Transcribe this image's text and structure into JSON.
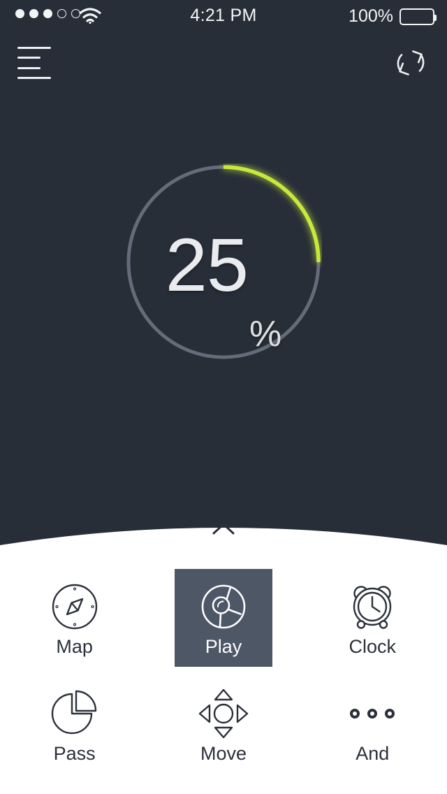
{
  "status_bar": {
    "signal_dots_total": 5,
    "signal_dots_filled": 3,
    "wifi_icon": "wifi-icon",
    "time": "4:21 PM",
    "battery_percent": "100%",
    "battery_level": 100,
    "battery_icon": "battery-full-icon"
  },
  "nav": {
    "menu_icon": "hamburger-menu-icon",
    "refresh_icon": "refresh-sync-icon"
  },
  "progress": {
    "value": 25,
    "value_text": "25",
    "unit": "%",
    "track_color": "#646c79",
    "arc_color": "#c9e83c",
    "start_angle_deg": 0,
    "sweep_deg": 90
  },
  "sheet": {
    "handle_icon": "chevron-up-icon",
    "background_color": "#ffffff"
  },
  "menu": {
    "selected_index": 1,
    "selected_bg": "#4d5766",
    "items": [
      {
        "label": "Map",
        "icon": "compass-icon"
      },
      {
        "label": "Play",
        "icon": "disc-spokes-icon"
      },
      {
        "label": "Clock",
        "icon": "alarm-clock-icon"
      },
      {
        "label": "Pass",
        "icon": "pie-chart-icon"
      },
      {
        "label": "Move",
        "icon": "dpad-arrows-icon"
      },
      {
        "label": "And",
        "icon": "ellipsis-circles-icon"
      }
    ]
  },
  "theme": {
    "background": "#282e38",
    "accent": "#c9e83c",
    "text_light": "#f2f4f6",
    "text_dark": "#2b303a"
  }
}
